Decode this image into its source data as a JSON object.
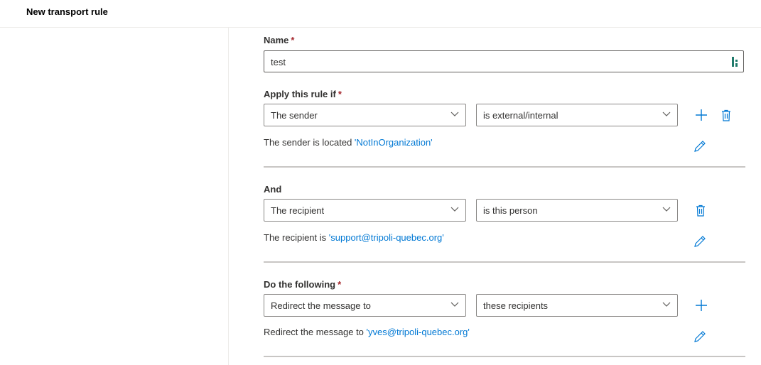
{
  "header": {
    "title": "New transport rule"
  },
  "name_field": {
    "label": "Name",
    "required": "*",
    "value": "test"
  },
  "apply_section": {
    "label": "Apply this rule if",
    "required": "*",
    "condition": "The sender",
    "operator": "is external/internal",
    "desc_prefix": "The sender is located ",
    "desc_link": "'NotInOrganization'"
  },
  "and_section": {
    "label": "And",
    "condition": "The recipient",
    "operator": "is this person",
    "desc_prefix": "The recipient is ",
    "desc_link": "'support@tripoli-quebec.org'"
  },
  "action_section": {
    "label": "Do the following",
    "required": "*",
    "action": "Redirect the message to",
    "target": "these recipients",
    "desc_prefix": "Redirect the message to ",
    "desc_link": "'yves@tripoli-quebec.org'"
  },
  "colors": {
    "accent": "#0078d4",
    "required": "#a4262c",
    "text": "#323130"
  },
  "icons": [
    "chevron-down-icon",
    "add-icon",
    "delete-icon",
    "edit-icon",
    "password-manager-icon"
  ]
}
